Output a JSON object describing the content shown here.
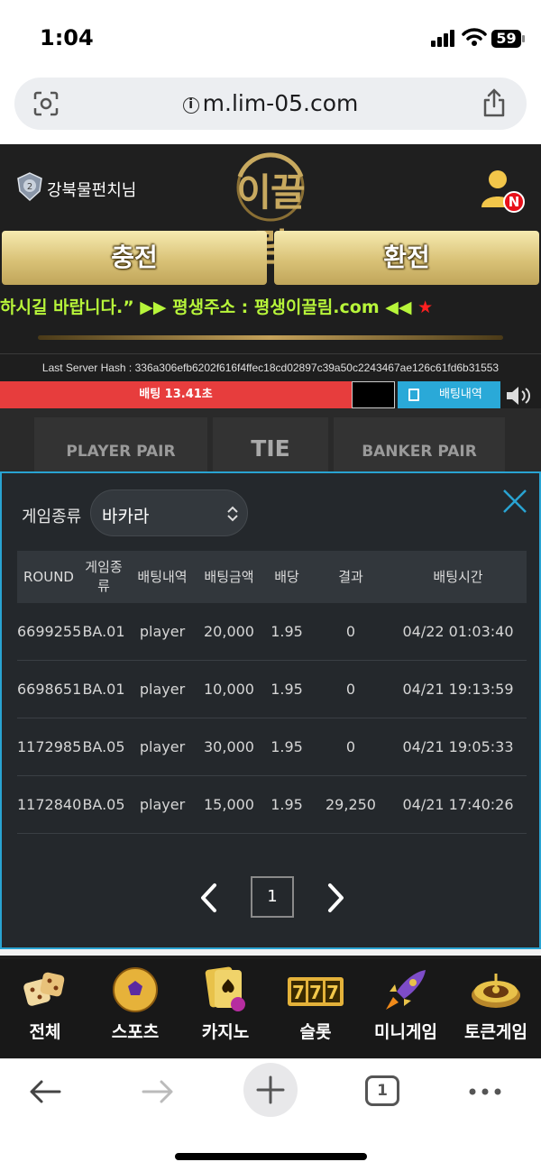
{
  "status": {
    "time": "1:04",
    "battery": "59"
  },
  "browser": {
    "url": "m.lim-05.com",
    "info_icon": "ⓘ",
    "tab_count": "1"
  },
  "header": {
    "username": "강북물펀치님",
    "logo": "이끌림",
    "notification_badge": "N",
    "charge_label": "충전",
    "exchange_label": "환전"
  },
  "marquee": {
    "text": "하시길 바랍니다.” ▶▶ 평생주소 : 평생이끌림.com ◀◀ ",
    "star": "★"
  },
  "server_hash": "Last Server Hash : 336a306efb6202f616f4ffec18cd02897c39a50c2243467ae126c61fd6b31553",
  "betting": {
    "timer_text": "배팅 13.41초",
    "history_label": "배팅내역"
  },
  "boards": {
    "player_pair": "PLAYER PAIR",
    "tie": "TIE",
    "banker_pair": "BANKER PAIR"
  },
  "modal": {
    "filter_label": "게임종류",
    "selected_game": "바카라",
    "columns": [
      "ROUND",
      "게임종\n류",
      "배팅내역",
      "배팅금액",
      "배당",
      "결과",
      "배팅시간"
    ],
    "rows": [
      [
        "6699255",
        "BA.01",
        "player",
        "20,000",
        "1.95",
        "0",
        "04/22 01:03:40"
      ],
      [
        "6698651",
        "BA.01",
        "player",
        "10,000",
        "1.95",
        "0",
        "04/21 19:13:59"
      ],
      [
        "1172985",
        "BA.05",
        "player",
        "30,000",
        "1.95",
        "0",
        "04/21 19:05:33"
      ],
      [
        "1172840",
        "BA.05",
        "player",
        "15,000",
        "1.95",
        "29,250",
        "04/21 17:40:26"
      ]
    ],
    "page": "1"
  },
  "game_nav": [
    {
      "label": "전체",
      "icon": "dice-icon"
    },
    {
      "label": "스포츠",
      "icon": "soccer-ball-icon"
    },
    {
      "label": "카지노",
      "icon": "cards-chips-icon"
    },
    {
      "label": "슬롯",
      "icon": "slot-777-icon"
    },
    {
      "label": "미니게임",
      "icon": "rocket-icon"
    },
    {
      "label": "토큰게임",
      "icon": "roulette-icon"
    }
  ],
  "colors": {
    "timer_bar": "#e73d3d",
    "history_button": "#2aa9d8",
    "modal_border": "#29a3d2",
    "marquee_text": "#b7f53a",
    "gold": "#c8a95f"
  }
}
